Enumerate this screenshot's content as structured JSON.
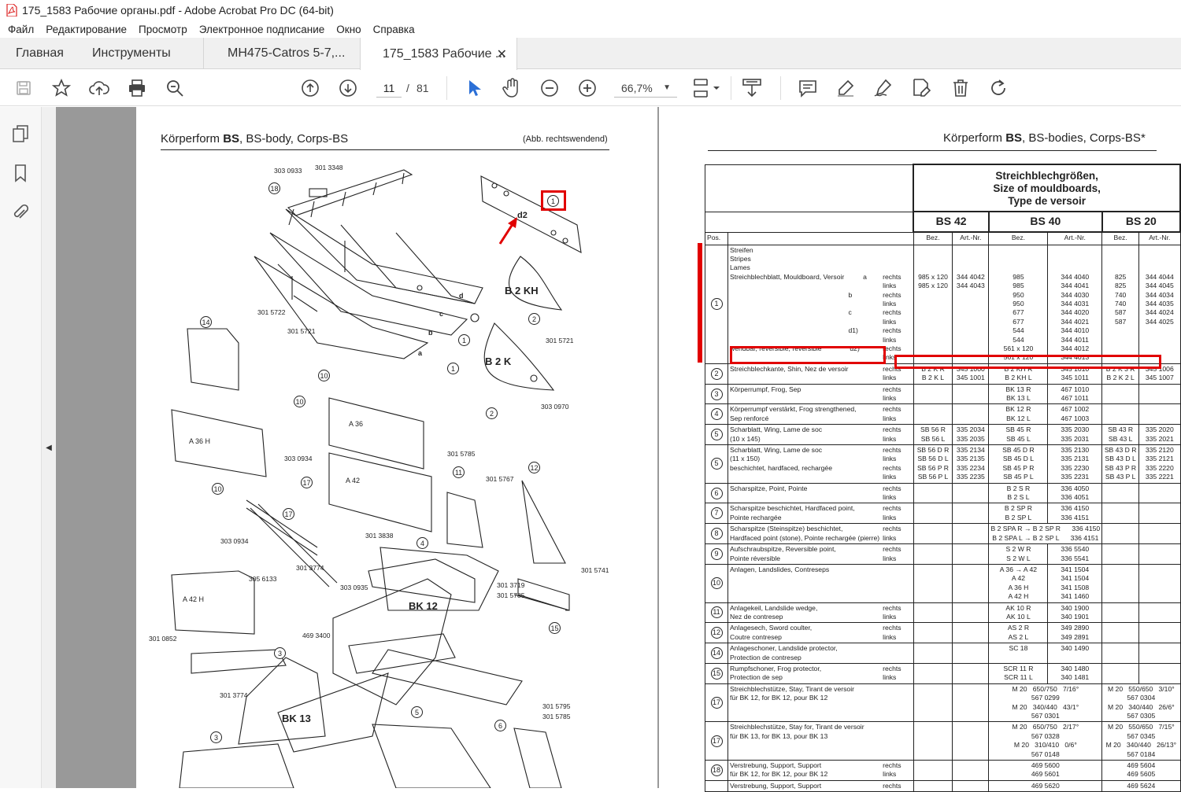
{
  "window": {
    "title": "175_1583 Рабочие органы.pdf - Adobe Acrobat Pro DC (64-bit)"
  },
  "menu": [
    "Файл",
    "Редактирование",
    "Просмотр",
    "Электронное подписание",
    "Окно",
    "Справка"
  ],
  "tabs": {
    "home": "Главная",
    "tools": "Инструменты",
    "doc1": "MH475-Catros 5-7,...",
    "doc2": "175_1583 Рабочие ..."
  },
  "toolbar": {
    "page_current": "11",
    "page_sep": "/",
    "page_total": "81",
    "zoom": "66,7%"
  },
  "left_page": {
    "title_pre": "Körperform ",
    "title_bold": "BS",
    "title_post": ", BS-body, Corps-BS",
    "note": "(Abb. rechtswendend)",
    "labels": {
      "l1": "303 0933",
      "l2": "301 3348",
      "l3": "301 5722",
      "l4": "301 5721",
      "l5": "301 5721",
      "l6": "303 0970",
      "l7": "303 0934",
      "l8": "301 5785",
      "l9": "301 5767",
      "l10": "303 0934",
      "l11": "301 3838",
      "l12": "301 3774",
      "l13": "305 6133",
      "l14": "303 0935",
      "l15": "301 3719",
      "l16": "301 5785",
      "l17": "301 5741",
      "l18": "469 3400",
      "l19": "301 0852",
      "l20": "301 3774",
      "l21": "301 5795",
      "l22": "301 5785"
    },
    "parts": {
      "b2kh": "B 2 KH",
      "b2k": "B 2 K",
      "a36": "A 36",
      "a36h": "A 36 H",
      "a42": "A 42",
      "a42h": "A 42 H",
      "bk12": "BK 12",
      "bk13": "BK 13",
      "d2": "d2",
      "dA": "d",
      "dB": "c",
      "dC": "b",
      "dD": "a"
    },
    "circles": {
      "c1a": "1",
      "c1b": "1",
      "c1c": "1",
      "c1d": "1",
      "c2a": "2",
      "c2b": "2",
      "c3a": "3",
      "c3b": "3",
      "c4": "4",
      "c5": "5",
      "c6": "6",
      "c10a": "10",
      "c10b": "10",
      "c10c": "10",
      "c11": "11",
      "c12": "12",
      "c14": "14",
      "c15": "15",
      "c17a": "17",
      "c17b": "17",
      "c18": "18"
    }
  },
  "right_page": {
    "title_pre": "Körperform ",
    "title_bold": "BS",
    "title_post": ", BS-bodies, Corps-BS*",
    "header": {
      "l1": "Streichblechgrößen,",
      "l2": "Size of mouldboards,",
      "l3": "Type de versoir"
    },
    "cols": {
      "bs42": "BS 42",
      "bs40": "BS 40",
      "bs20": "BS 20",
      "pos": "Pos.",
      "bez": "Bez.",
      "art": "Art.-Nr."
    },
    "rows": [
      {
        "pos": "1",
        "desc": "Streifen\nStripes\nLames\nStreichblechblatt, Mouldboard, Versoir          a\n\n                                                               b\n\n                                                               c\n\n                                                               d1)\n\nwendbar, reversible, réversible               d2)",
        "side": "\n\n\nrechts\nlinks\nrechts\nlinks\nrechts\nlinks\nrechts\nlinks\nrechts\nlinks",
        "a1": "\n\n\n985 x 120\n985 x 120",
        "a2": "\n\n\n344 4042\n344 4043",
        "b1": "\n\n\n985\n985\n950\n950\n677\n677\n544\n544\n561 x 120\n561 x 120",
        "b2": "\n\n\n344 4040\n344 4041\n344 4030\n344 4031\n344 4020\n344 4021\n344 4010\n344 4011\n344 4012\n344 4013",
        "c1": "\n\n\n825\n825\n740\n740\n587\n587",
        "c2": "\n\n\n344 4044\n344 4045\n344 4034\n344 4035\n344 4024\n344 4025"
      },
      {
        "pos": "2",
        "desc": "Streichblechkante, Shin, Nez de versoir",
        "side": "rechts\nlinks",
        "a1": "B 2 K R\nB 2 K L",
        "a2": "345 1000\n345 1001",
        "b1": "B 2 KH R\nB 2 KH L",
        "b2": "345 1010\n345 1011",
        "c1": "B 2 K 3 R\nB 2 K 2 L",
        "c2": "345 1006\n345 1007"
      },
      {
        "pos": "3",
        "desc": "Körperrumpf, Frog, Sep",
        "side": "rechts\nlinks",
        "a1": "",
        "a2": "",
        "b1": "BK 13 R\nBK 13 L",
        "b2": "467 1010\n467 1011",
        "c1": "",
        "c2": ""
      },
      {
        "pos": "4",
        "desc": "Körperrumpf verstärkt, Frog strengthened,\nSep renforcé",
        "side": "rechts\nlinks",
        "a1": "",
        "a2": "",
        "b1": "BK 12 R\nBK 12 L",
        "b2": "467 1002\n467 1003",
        "c1": "",
        "c2": ""
      },
      {
        "pos": "5",
        "desc": "Scharblatt, Wing, Lame de soc\n(10 x 145)",
        "side": "rechts\nlinks",
        "a1": "SB 56 R\nSB 56 L",
        "a2": "335 2034\n335 2035",
        "b1": "SB 45 R\nSB 45 L",
        "b2": "335 2030\n335 2031",
        "c1": "SB 43 R\nSB 43 L",
        "c2": "335 2020\n335 2021"
      },
      {
        "pos": "5",
        "desc": "Scharblatt, Wing, Lame de soc\n(11 x 150)\nbeschichtet, hardfaced, rechargée",
        "side": "rechts\nlinks\nrechts\nlinks",
        "a1": "SB 56 D R\nSB 56 D L\nSB 56 P R\nSB 56 P L",
        "a2": "335 2134\n335 2135\n335 2234\n335 2235",
        "b1": "SB 45 D R\nSB 45 D L\nSB 45 P R\nSB 45 P L",
        "b2": "335 2130\n335 2131\n335 2230\n335 2231",
        "c1": "SB 43 D R\nSB 43 D L\nSB 43 P R\nSB 43 P L",
        "c2": "335 2120\n335 2121\n335 2220\n335 2221"
      },
      {
        "pos": "6",
        "desc": "Scharspitze, Point, Pointe",
        "side": "rechts\nlinks",
        "a1": "",
        "a2": "",
        "b1": "B 2 S R\nB 2 S L",
        "b2": "336 4050\n336 4051",
        "c1": "",
        "c2": ""
      },
      {
        "pos": "7",
        "desc": "Scharspitze beschichtet, Hardfaced point,\nPointe rechargée",
        "side": "rechts\nlinks",
        "a1": "",
        "a2": "",
        "b1": "B 2 SP R\nB 2 SP L",
        "b2": "336 4150\n336 4151",
        "c1": "",
        "c2": ""
      },
      {
        "pos": "8",
        "desc": "Scharspitze (Steinspitze) beschichtet,\nHardfaced point (stone), Pointe rechargée (pierre)",
        "side": "rechts\nlinks",
        "a1": "",
        "a2": "",
        "b1": "B 2 SPA R → B 2 SP R      336 4150\nB 2 SPA L → B 2 SP L      336 4151",
        "b2": "",
        "c1": "",
        "c2": ""
      },
      {
        "pos": "9",
        "desc": "Aufschraubspitze, Reversible point,\nPointe réversible",
        "side": "rechts\nlinks",
        "a1": "",
        "a2": "",
        "b1": "S 2 W R\nS 2 W L",
        "b2": "336 5540\n336 5541",
        "c1": "",
        "c2": ""
      },
      {
        "pos": "10",
        "desc": "Anlagen, Landslides, Contreseps",
        "side": "",
        "a1": "",
        "a2": "",
        "b1": "A 36 → A 42\nA 42\nA 36 H\nA 42 H",
        "b2": "341 1504\n341 1504\n341 1508\n341 1460",
        "c1": "",
        "c2": ""
      },
      {
        "pos": "11",
        "desc": "Anlagekeil, Landslide wedge,\nNez de contresep",
        "side": "rechts\nlinks",
        "a1": "",
        "a2": "",
        "b1": "AK 10 R\nAK 10 L",
        "b2": "340 1900\n340 1901",
        "c1": "",
        "c2": ""
      },
      {
        "pos": "12",
        "desc": "Anlagesech, Sword coulter,\nCoutre contresep",
        "side": "rechts\nlinks",
        "a1": "",
        "a2": "",
        "b1": "AS 2 R\nAS 2 L",
        "b2": "349 2890\n349 2891",
        "c1": "",
        "c2": ""
      },
      {
        "pos": "14",
        "desc": "Anlageschoner, Landslide protector,\nProtection de contresep",
        "side": "",
        "a1": "",
        "a2": "",
        "b1": "SC 18",
        "b2": "340 1490",
        "c1": "",
        "c2": ""
      },
      {
        "pos": "15",
        "desc": "Rumpfschoner, Frog protector,\nProtection de sep",
        "side": "rechts\nlinks",
        "a1": "",
        "a2": "",
        "b1": "SCR 11 R\nSCR 11 L",
        "b2": "340 1480\n340 1481",
        "c1": "",
        "c2": ""
      },
      {
        "pos": "17",
        "desc": "Streichblechstütze, Stay, Tirant de versoir\nfür BK 12, for BK 12, pour BK 12",
        "side": "",
        "a1": "",
        "a2": "",
        "b1": "M 20   650/750   7/16°\n567 0299\nM 20   340/440   43/1°\n567 0301",
        "b2": "",
        "c1": "M 20   550/650   3/10°\n567 0304\nM 20   340/440   26/6°\n567 0305",
        "c2": ""
      },
      {
        "pos": "17",
        "desc": "Streichblechstütze, Stay for, Tirant de versoir\nfür BK 13, for BK 13, pour BK 13",
        "side": "",
        "a1": "",
        "a2": "",
        "b1": "M 20   650/750   2/17°\n567 0328\nM 20   310/410   0/6°\n567 0148",
        "b2": "",
        "c1": "M 20   550/650   7/15°\n567 0345\nM 20   340/440   26/13°\n567 0184",
        "c2": ""
      },
      {
        "pos": "18",
        "desc": "Verstrebung, Support, Support\nfür BK 12, for BK 12, pour BK 12",
        "side": "rechts\nlinks",
        "a1": "",
        "a2": "",
        "b1": "469 5600\n469 5601",
        "b2": "",
        "c1": "469 5604\n469 5605",
        "c2": ""
      },
      {
        "pos": "",
        "desc": "Verstrebung, Support, Support",
        "side": "rechts",
        "a1": "",
        "a2": "",
        "b1": "469 5620",
        "b2": "",
        "c1": "469 5624",
        "c2": ""
      }
    ]
  },
  "colors": {
    "accent": "#2b6fd6",
    "annotation_red": "#e10000",
    "canvas": "#999999"
  }
}
